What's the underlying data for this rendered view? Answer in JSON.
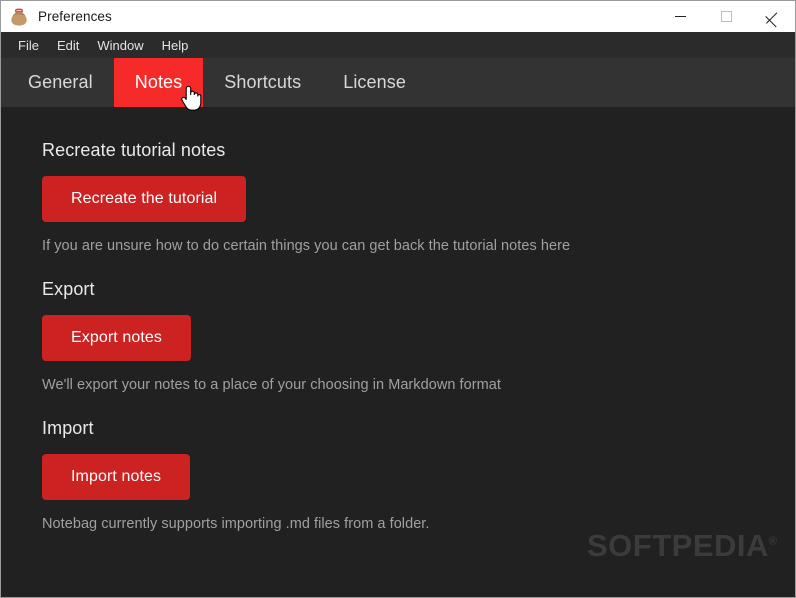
{
  "window": {
    "title": "Preferences",
    "icon": "bag-icon",
    "controls": {
      "minimize": "Minimize",
      "maximize": "Maximize",
      "close": "Close"
    }
  },
  "menubar": {
    "items": [
      {
        "label": "File"
      },
      {
        "label": "Edit"
      },
      {
        "label": "Window"
      },
      {
        "label": "Help"
      }
    ]
  },
  "tabs": {
    "active_index": 1,
    "items": [
      {
        "label": "General"
      },
      {
        "label": "Notes"
      },
      {
        "label": "Shortcuts"
      },
      {
        "label": "License"
      }
    ]
  },
  "sections": [
    {
      "heading": "Recreate tutorial notes",
      "button": "Recreate the tutorial",
      "description": "If you are unsure how to do certain things you can get back the tutorial notes here"
    },
    {
      "heading": "Export",
      "button": "Export notes",
      "description": "We'll export your notes to a place of your choosing in Markdown format"
    },
    {
      "heading": "Import",
      "button": "Import notes",
      "description": "Notebag currently supports importing .md files from a folder."
    }
  ],
  "watermark": {
    "text": "SOFTPEDIA",
    "mark": "®"
  },
  "colors": {
    "accent_tab": "#f72a2a",
    "accent_button": "#cd2222",
    "titlebar_bg": "#ffffff",
    "menubar_bg": "#2b2b2b",
    "tabbar_bg": "#333333",
    "content_bg": "#212121",
    "heading_text": "#e9e9e9",
    "description_text": "#a0a0a0",
    "watermark": "#3b3b3b"
  }
}
